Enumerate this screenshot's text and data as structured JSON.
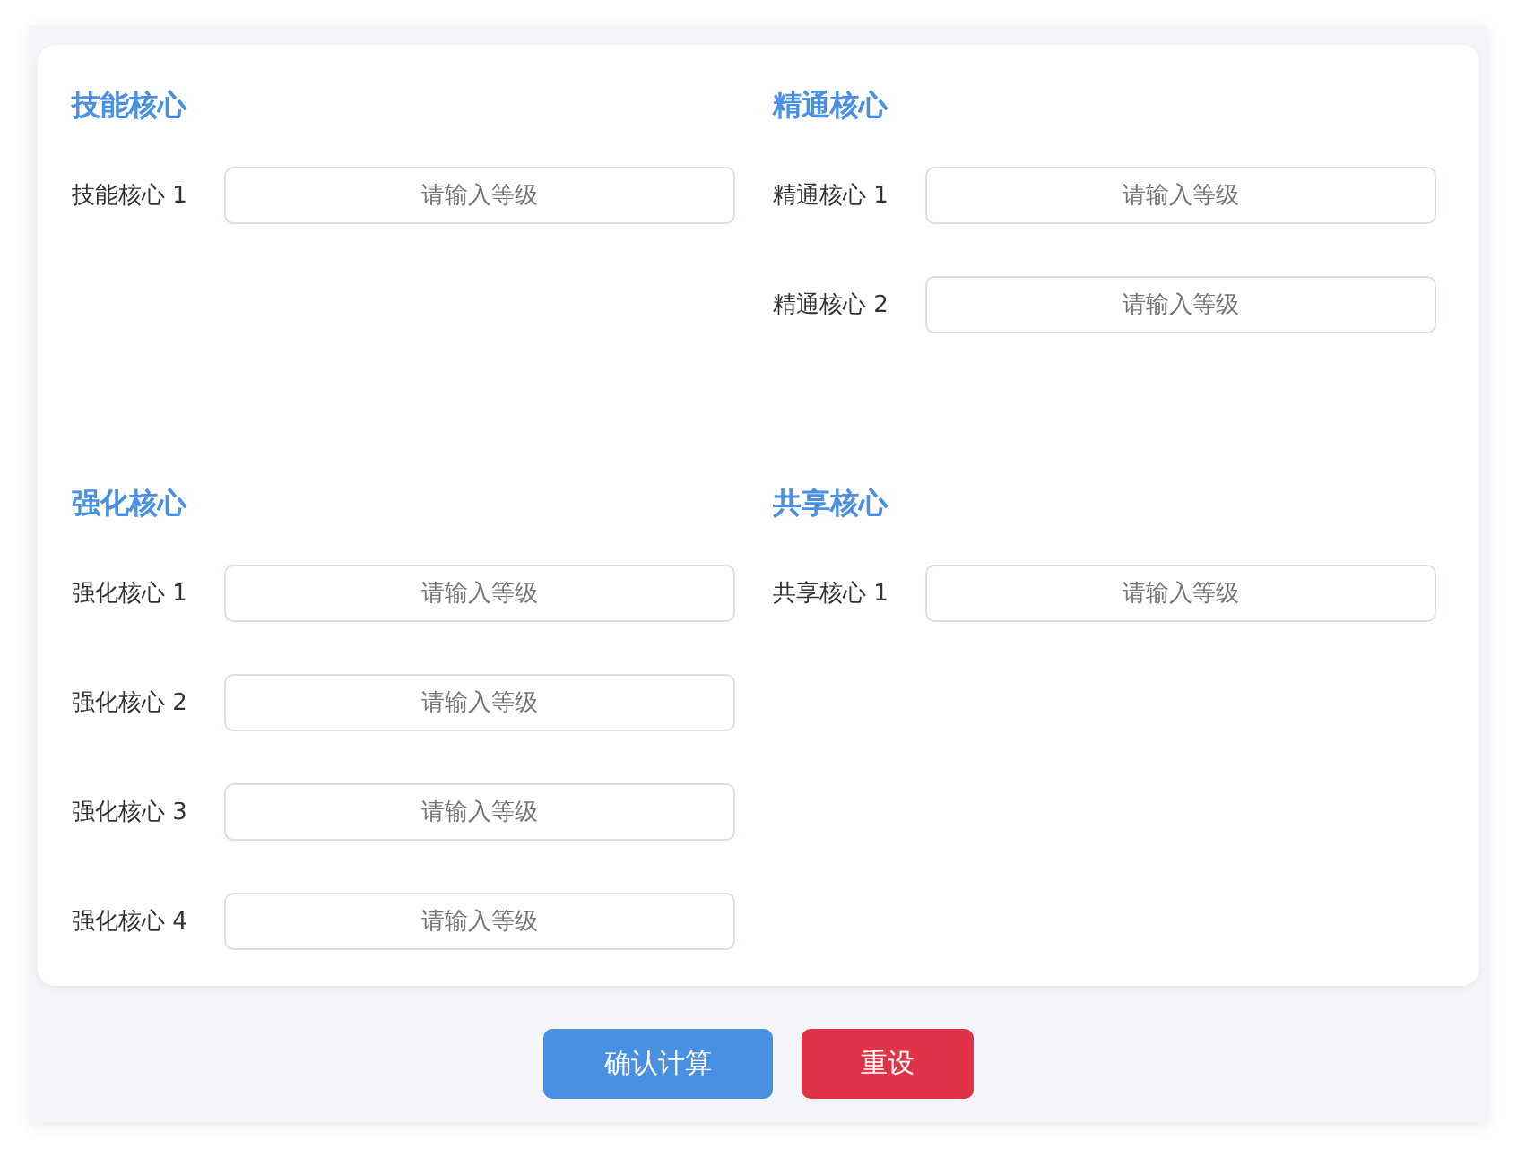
{
  "sections": [
    {
      "title": "技能核心",
      "fields": [
        {
          "label": "技能核心 1",
          "placeholder": "请输入等级"
        }
      ]
    },
    {
      "title": "精通核心",
      "fields": [
        {
          "label": "精通核心 1",
          "placeholder": "请输入等级"
        },
        {
          "label": "精通核心 2",
          "placeholder": "请输入等级"
        }
      ]
    },
    {
      "title": "强化核心",
      "fields": [
        {
          "label": "强化核心 1",
          "placeholder": "请输入等级"
        },
        {
          "label": "强化核心 2",
          "placeholder": "请输入等级"
        },
        {
          "label": "强化核心 3",
          "placeholder": "请输入等级"
        },
        {
          "label": "强化核心 4",
          "placeholder": "请输入等级"
        }
      ]
    },
    {
      "title": "共享核心",
      "fields": [
        {
          "label": "共享核心 1",
          "placeholder": "请输入等级"
        }
      ]
    }
  ],
  "buttons": [
    {
      "label": "确认计算",
      "kind": "primary"
    },
    {
      "label": "重设",
      "kind": "danger"
    }
  ]
}
